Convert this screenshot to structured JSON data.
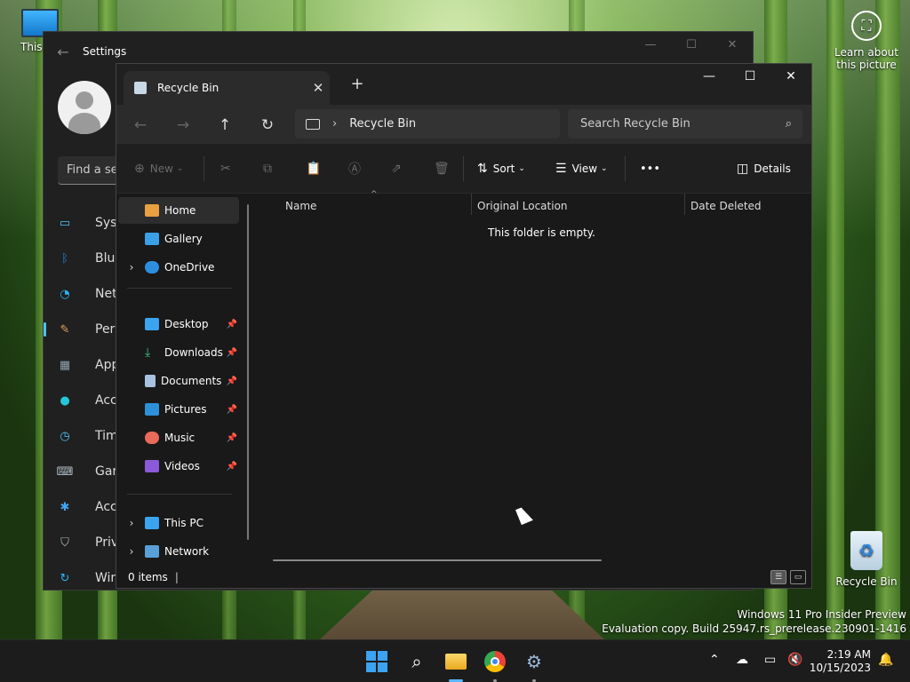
{
  "desktop": {
    "this_pc_label": "This PC",
    "recycle_bin_label": "Recycle Bin",
    "learn_line1": "Learn about",
    "learn_line2": "this picture",
    "watermark_line1": "Windows 11 Pro Insider Preview",
    "watermark_line2": "Evaluation copy. Build 25947.rs_prerelease.230901-1416"
  },
  "settings": {
    "title": "Settings",
    "search_placeholder": "Find a se",
    "nav": [
      {
        "label": "Syst",
        "icon": "system-icon",
        "color": "#4fc3f7"
      },
      {
        "label": "Blue",
        "icon": "bluetooth-icon",
        "color": "#1e88e5"
      },
      {
        "label": "Net",
        "icon": "network-icon",
        "color": "#29b6f6"
      },
      {
        "label": "Pers",
        "icon": "brush-icon",
        "color": "#e0a060",
        "active": true
      },
      {
        "label": "App",
        "icon": "apps-icon",
        "color": "#90a4ae"
      },
      {
        "label": "Acc",
        "icon": "accounts-icon",
        "color": "#26c6da"
      },
      {
        "label": "Tim",
        "icon": "time-icon",
        "color": "#4fc3f7"
      },
      {
        "label": "Gan",
        "icon": "gaming-icon",
        "color": "#b0bec5"
      },
      {
        "label": "Acc",
        "icon": "accessibility-icon",
        "color": "#42a5f5"
      },
      {
        "label": "Priv",
        "icon": "shield-icon",
        "color": "#b0bec5"
      },
      {
        "label": "Win",
        "icon": "update-icon",
        "color": "#29b6f6"
      }
    ]
  },
  "explorer": {
    "tab_title": "Recycle Bin",
    "address": "Recycle Bin",
    "search_placeholder": "Search Recycle Bin",
    "commands": {
      "new": "New",
      "sort": "Sort",
      "view": "View",
      "more": "•••",
      "details": "Details"
    },
    "nav": {
      "home": "Home",
      "gallery": "Gallery",
      "onedrive": "OneDrive",
      "desktop": "Desktop",
      "downloads": "Downloads",
      "documents": "Documents",
      "pictures": "Pictures",
      "music": "Music",
      "videos": "Videos",
      "this_pc": "This PC",
      "network": "Network"
    },
    "columns": [
      "Name",
      "Original Location",
      "Date Deleted"
    ],
    "empty_message": "This folder is empty.",
    "status": "0 items"
  },
  "taskbar": {
    "time": "2:19 AM",
    "date": "10/15/2023"
  },
  "colors": {
    "accent": "#4cc2ff",
    "window_bg": "#191919",
    "taskbar_bg": "#1c1c1c"
  }
}
